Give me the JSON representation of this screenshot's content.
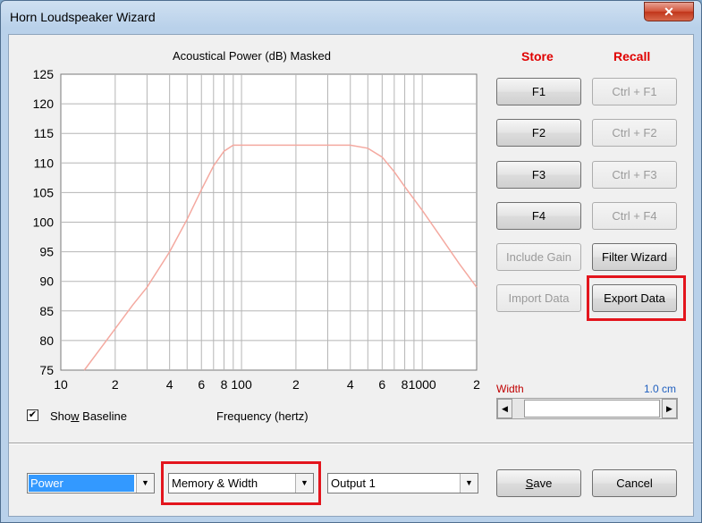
{
  "window": {
    "title": "Horn Loudspeaker Wizard",
    "close_glyph": "✕"
  },
  "chart_header": {
    "title": "Acoustical Power (dB)   Masked"
  },
  "chart_data": {
    "type": "line",
    "title": "Acoustical Power (dB)   Masked",
    "xlabel": "Frequency (hertz)",
    "ylabel": "",
    "x_scale": "log",
    "xlim": [
      10,
      2000
    ],
    "ylim": [
      75,
      125
    ],
    "y_ticks": [
      75,
      80,
      85,
      90,
      95,
      100,
      105,
      110,
      115,
      120,
      125
    ],
    "x_tick_labels": [
      {
        "value": 10,
        "label": "10"
      },
      {
        "value": 20,
        "label": "2"
      },
      {
        "value": 40,
        "label": "4"
      },
      {
        "value": 60,
        "label": "6"
      },
      {
        "value": 80,
        "label": "8"
      },
      {
        "value": 100,
        "label": "100"
      },
      {
        "value": 200,
        "label": "2"
      },
      {
        "value": 400,
        "label": "4"
      },
      {
        "value": 600,
        "label": "6"
      },
      {
        "value": 800,
        "label": "8"
      },
      {
        "value": 1000,
        "label": "1000"
      },
      {
        "value": 2000,
        "label": "2"
      }
    ],
    "grid": true,
    "line_color": "#f4a9a0",
    "series": [
      {
        "x": [
          13.5,
          16,
          20,
          25,
          30,
          40,
          50,
          60,
          70,
          80,
          90,
          100,
          150,
          200,
          300,
          400,
          500,
          600,
          700,
          800,
          1000,
          1300,
          1600,
          2000
        ],
        "y": [
          75,
          78,
          82,
          86,
          89,
          95,
          100.5,
          105.5,
          109.5,
          112,
          113,
          113,
          113,
          113,
          113,
          113,
          112.5,
          111,
          108.5,
          106,
          102,
          97,
          93,
          89
        ]
      }
    ]
  },
  "right_panel": {
    "store_label": "Store",
    "recall_label": "Recall",
    "store_buttons": [
      "F1",
      "F2",
      "F3",
      "F4"
    ],
    "recall_buttons": [
      "Ctrl + F1",
      "Ctrl + F2",
      "Ctrl + F3",
      "Ctrl + F4"
    ],
    "include_gain": "Include Gain",
    "filter_wizard": "Filter Wizard",
    "import_data": "Import Data",
    "export_data": "Export Data",
    "width_label": "Width",
    "width_value": "1.0 cm",
    "scroll_left": "◀",
    "scroll_right": "▶"
  },
  "baseline": {
    "checked_glyph": "✔",
    "label_pre": "Sho",
    "label_mnemonic": "w",
    "label_post": " Baseline"
  },
  "bottom": {
    "combo1_value": "Power",
    "combo2_value": "Memory & Width",
    "combo3_value": "Output 1",
    "dropdown_glyph": "▼",
    "save_mnemonic": "S",
    "save_rest": "ave",
    "cancel_label": "Cancel"
  },
  "colors": {
    "highlight": "#e3151d",
    "header_red": "#e00000",
    "width_blue": "#1f5fbf"
  }
}
